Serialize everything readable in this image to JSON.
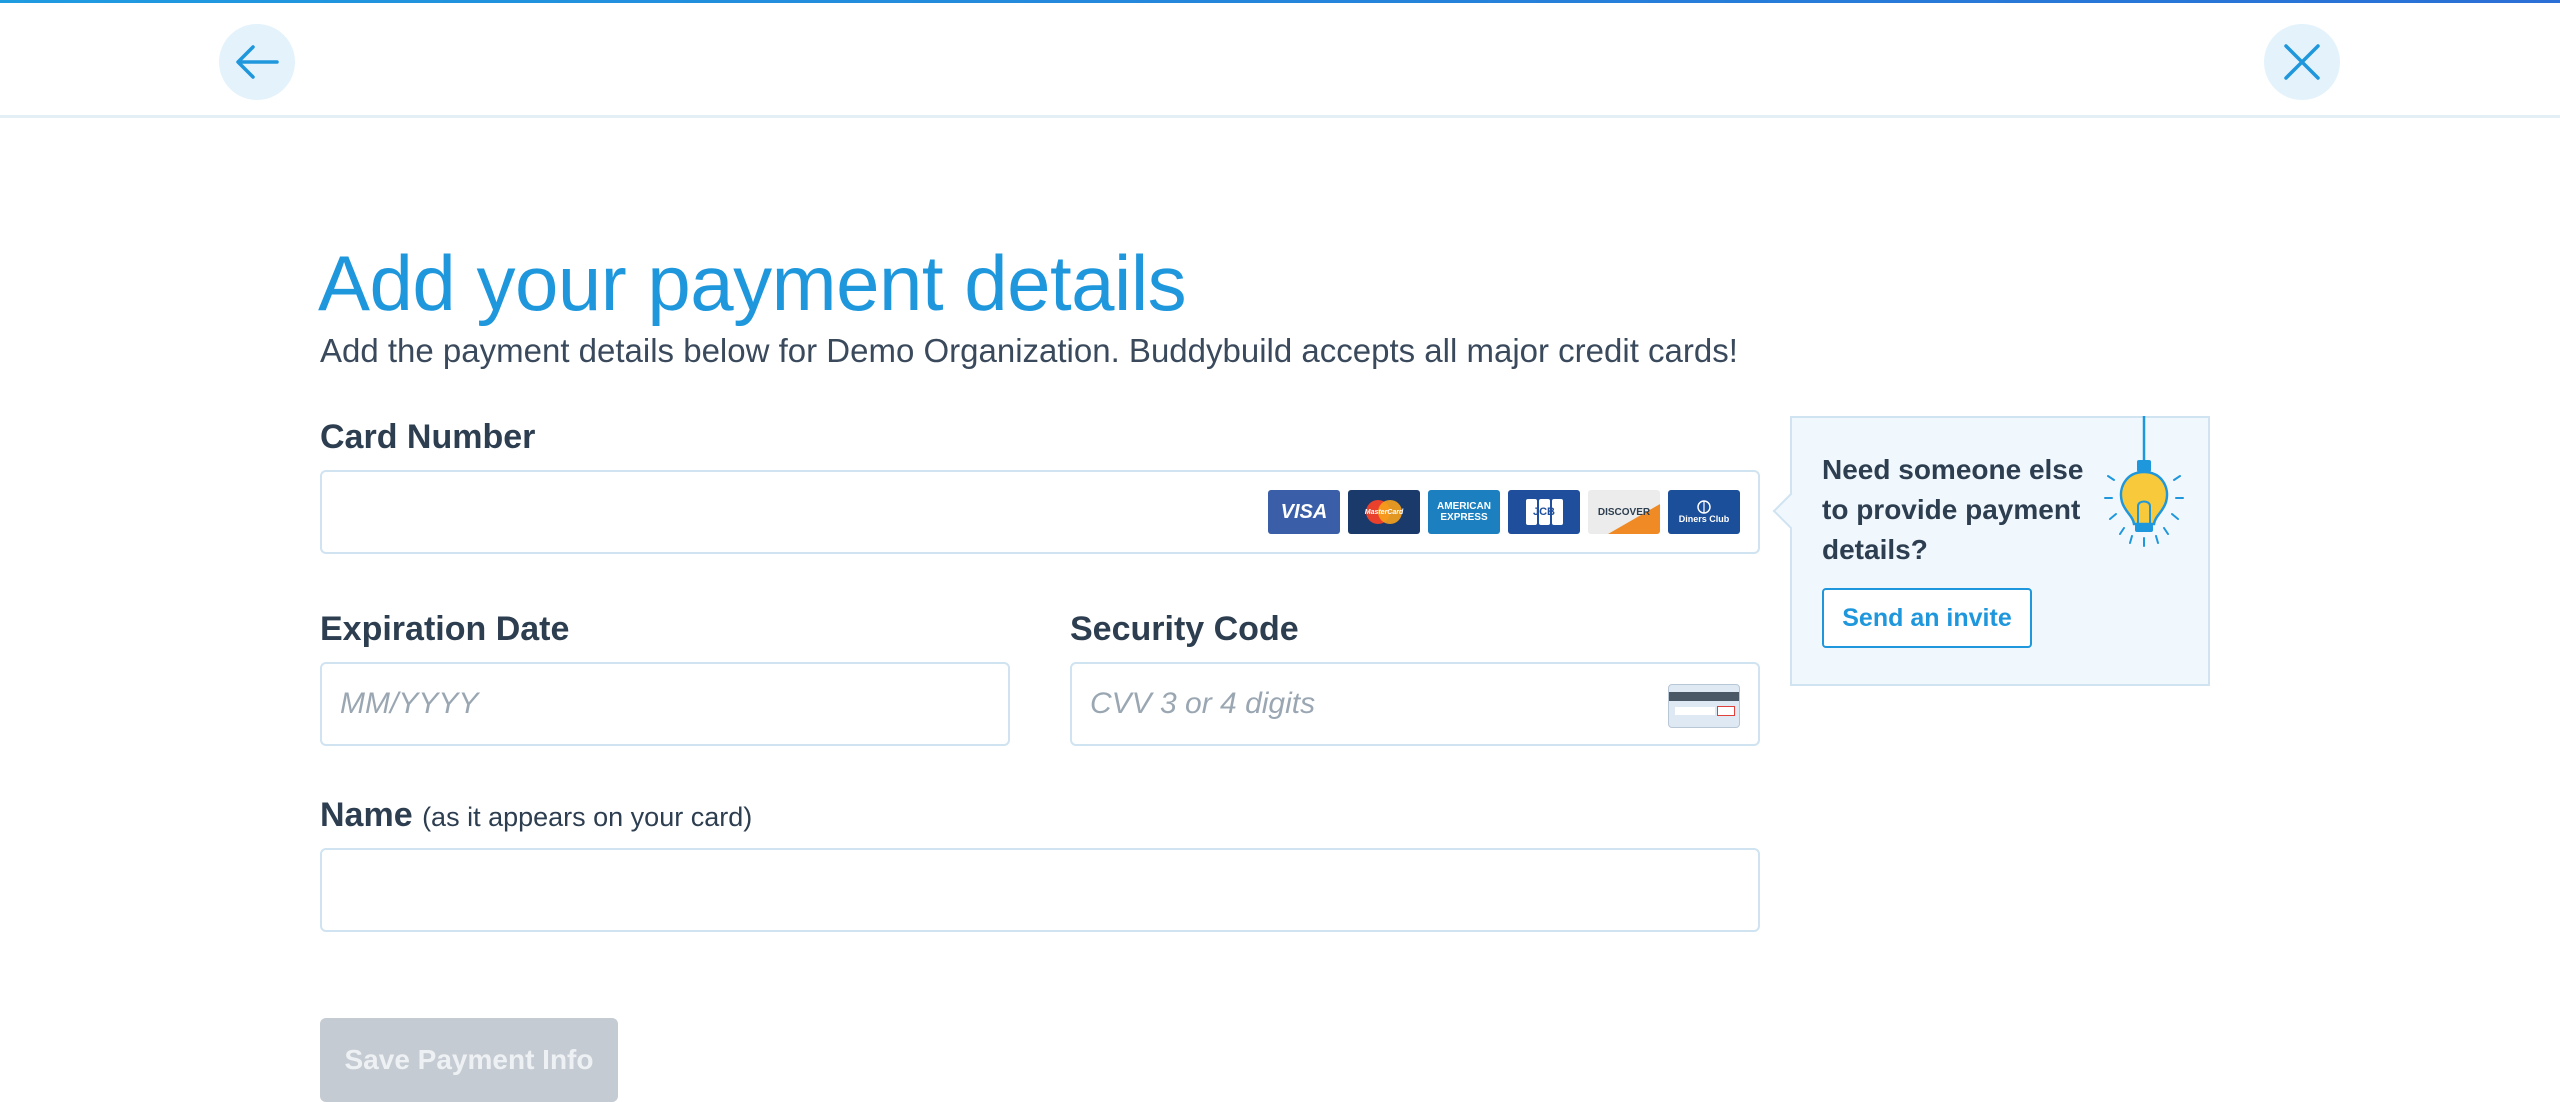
{
  "header": {
    "back_icon": "arrow-left-icon",
    "close_icon": "close-icon"
  },
  "page": {
    "title": "Add your payment details",
    "subtitle": "Add the payment details below for Demo Organization. Buddybuild accepts all major credit cards!"
  },
  "form": {
    "card_number": {
      "label": "Card Number",
      "value": "",
      "placeholder": "",
      "card_brands": [
        {
          "name": "VISA",
          "icon": "visa-icon"
        },
        {
          "name": "MasterCard",
          "icon": "mastercard-icon"
        },
        {
          "name": "AMERICAN EXPRESS",
          "icon": "amex-icon"
        },
        {
          "name": "JCB",
          "icon": "jcb-icon"
        },
        {
          "name": "DISCOVER",
          "icon": "discover-icon"
        },
        {
          "name": "Diners Club",
          "icon": "diners-club-icon"
        }
      ]
    },
    "expiration": {
      "label": "Expiration Date",
      "value": "",
      "placeholder": "MM/YYYY"
    },
    "security_code": {
      "label": "Security Code",
      "value": "",
      "placeholder": "CVV 3 or 4 digits",
      "icon": "cvv-card-icon"
    },
    "name": {
      "label": "Name",
      "hint": "(as it appears on your card)",
      "value": "",
      "placeholder": ""
    },
    "save_label": "Save Payment Info"
  },
  "invite": {
    "text": "Need someone else to provide payment details?",
    "button_label": "Send an invite",
    "icon": "lightbulb-icon"
  },
  "colors": {
    "accent": "#1f97dc",
    "text": "#2d3e50",
    "panel_bg": "#f1f8fd",
    "disabled_button": "#c5cbd2"
  }
}
